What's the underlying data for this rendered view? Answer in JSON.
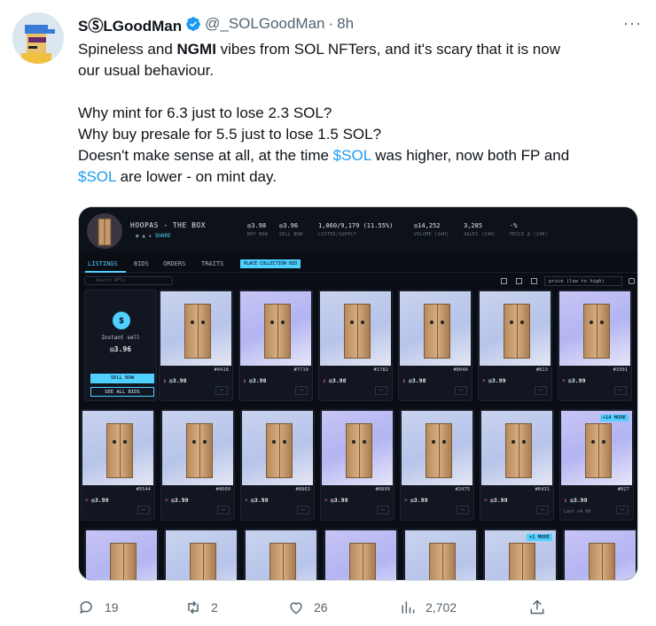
{
  "tweet": {
    "display_name": "SⓈLGoodMan",
    "handle": "@_SOLGoodMan",
    "sep": "·",
    "time": "8h",
    "line1_a": "Spineless and ",
    "line1_b": "NGMI",
    "line1_c": " vibes from SOL NFTers, and it's scary that it is now",
    "line2": "our usual behaviour.",
    "line3": "Why mint for 6.3 just to lose 2.3 SOL?",
    "line4": "Why buy presale for 5.5 just to lose 1.5 SOL?",
    "line5_a": "Doesn't make sense at all, at the time ",
    "line5_cash": "$SOL",
    "line5_b": " was higher, now both FP and",
    "line6_cash": "$SOL",
    "line6_b": " are lower - on mint day."
  },
  "media": {
    "collection_name": "HOOPAS - THE BOX",
    "share": "SHARE",
    "stats": [
      {
        "value": "◎3.98",
        "label": "BUY NOW"
      },
      {
        "value": "◎3.96",
        "label": "SELL NOW"
      },
      {
        "value": "1,060/9,179 (11.55%)",
        "label": "LISTED/SUPPLY"
      },
      {
        "value": "◎14,252",
        "label": "VOLUME (24H)"
      },
      {
        "value": "3,285",
        "label": "SALES (24H)"
      },
      {
        "value": "-%",
        "label": "PRICE Δ (24H)"
      }
    ],
    "tabs": [
      "LISTINGS",
      "BIDS",
      "ORDERS",
      "TRAITS"
    ],
    "place_bid": "PLACE COLLECTION BID",
    "search_placeholder": "Search NFTs",
    "sort": "price (low to high)",
    "instant": {
      "label": "Instant sell",
      "price": "◎3.96",
      "sell": "SELL NOW",
      "bids": "SEE ALL BIDS"
    },
    "cards": [
      {
        "num": "#4418",
        "price": "◎3.98",
        "tag": "↥"
      },
      {
        "num": "#7710",
        "price": "◎3.98",
        "tag": "↥"
      },
      {
        "num": "#1782",
        "price": "◎3.98",
        "tag": "↥"
      },
      {
        "num": "#8046",
        "price": "◎3.98",
        "tag": "↥"
      },
      {
        "num": "#813",
        "price": "◎3.99",
        "tag": "☀"
      },
      {
        "num": "#3301",
        "price": "◎3.99",
        "tag": "☀"
      },
      {
        "num": "#5544",
        "price": "◎3.99",
        "tag": "☀"
      },
      {
        "num": "#4660",
        "price": "◎3.99",
        "tag": "☀"
      },
      {
        "num": "#8863",
        "price": "◎3.99",
        "tag": "☀"
      },
      {
        "num": "#6899",
        "price": "◎3.99",
        "tag": "☀"
      },
      {
        "num": "#2475",
        "price": "◎3.99",
        "tag": "☀"
      },
      {
        "num": "#6431",
        "price": "◎3.99",
        "tag": "☀"
      },
      {
        "num": "#827",
        "price": "◎3.99",
        "tag": "↥",
        "last": "Last ◎4.00",
        "more": "+14 MORE"
      }
    ],
    "row3_more": "+1 MORE"
  },
  "actions": {
    "replies": "19",
    "retweets": "2",
    "likes": "26",
    "views": "2,702"
  },
  "colors": {
    "accent": "#1d9bf0",
    "mint": "#4fd0ff"
  }
}
